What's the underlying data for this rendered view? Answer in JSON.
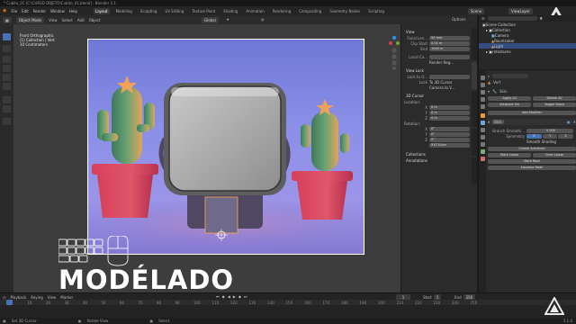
{
  "titlebar": {
    "title": "* Cubito_01 [C:\\CURSO OBJETO\\Cubito_01.blend] - Blender 3.1"
  },
  "menubar": {
    "menus": [
      "File",
      "Edit",
      "Render",
      "Window",
      "Help"
    ],
    "workspaces": [
      "Layout",
      "Modeling",
      "Sculpting",
      "UV Editing",
      "Texture Paint",
      "Shading",
      "Animation",
      "Rendering",
      "Compositing",
      "Geometry Nodes",
      "Scripting"
    ],
    "active_workspace": "Layout",
    "scene": "Scene",
    "view_layer": "ViewLayer"
  },
  "header": {
    "mode": "Object Mode",
    "menus": [
      "View",
      "Select",
      "Add",
      "Object"
    ],
    "orientation_label": "Orientation:",
    "orientation": "Default",
    "drag_label": "Drag:",
    "drag": "Select Box",
    "transform": "Global",
    "options": "Options"
  },
  "viewport": {
    "info": [
      "Front Orthographic",
      "(1) Collection | Vert",
      "10 Centimeters"
    ]
  },
  "npanel": {
    "tabs": [
      "Item",
      "Tool",
      "View",
      "Node Wrangler",
      "Edit",
      "Create"
    ],
    "view_section": "View",
    "focal_length_label": "Focal Len...",
    "focal_length": "50 mm",
    "clip_start_label": "Clip Start",
    "clip_start": "0.01 m",
    "clip_end_label": "End",
    "clip_end": "1000 m",
    "local_camera_label": "Local Ca...",
    "render_region": "Render Reg...",
    "view_lock": "View Lock",
    "lock_object_label": "Lock to O...",
    "lock_label": "Lock",
    "to_3d_cursor": "To 3D Cursor",
    "camera_to_view": "Camera to V...",
    "cursor_3d": "3D Cursor",
    "location_label": "Location:",
    "loc_x": "0 m",
    "loc_y": "0 m",
    "loc_z": "0 m",
    "rotation_label": "Rotation:",
    "rot_x": "0°",
    "rot_y": "0°",
    "rot_z": "0°",
    "rot_mode": "XYZ Euler",
    "collections": "Collections",
    "annotations": "Annotations"
  },
  "outliner": {
    "header": "Scene Collection",
    "items": [
      "Collection",
      "Camera",
      "Rountcaker",
      "Light",
      "rotextures"
    ]
  },
  "properties": {
    "object_name": "Vert",
    "modifier_label": "Skin",
    "apply_all": "Apply All",
    "delete_all": "Delete All",
    "viewport_vis": "Viewport Vis",
    "toggle_stack": "Toggle Stack",
    "add_modifier": "Add Modifier",
    "modifier_name": "Skin",
    "branch_smoothing_label": "Branch Smoothi...",
    "branch_smoothing": "0.000",
    "symmetry_label": "Symmetry",
    "sym_x": "X",
    "sym_y": "Y",
    "sym_z": "Z",
    "smooth_shading": "Smooth Shading",
    "create_armature": "Create Armature",
    "mark_loose": "Mark Loose",
    "clear_loose": "Clear Loose",
    "mark_root": "Mark Root",
    "equalize_radii": "Equalize Radii"
  },
  "timeline": {
    "menus": [
      "Playback",
      "Keying",
      "View",
      "Marker"
    ],
    "start_label": "Start",
    "start": "1",
    "end_label": "End",
    "end": "250",
    "current_frame": "1",
    "ticks": [
      "0",
      "10",
      "20",
      "30",
      "40",
      "50",
      "60",
      "70",
      "80",
      "90",
      "100",
      "110",
      "120",
      "130",
      "140",
      "150",
      "160",
      "170",
      "180",
      "190",
      "200",
      "210",
      "220",
      "230",
      "240",
      "250"
    ]
  },
  "statusbar": {
    "items": [
      "Set 3D Cursor",
      "Rotate View",
      "Select"
    ],
    "version": "3.1.0"
  },
  "overlay": {
    "caption": "MODÉLADO"
  },
  "colors": {
    "accent": "#4772b3",
    "ui_bg": "#2b2b2b",
    "active_orange": "#ff9c2b"
  }
}
